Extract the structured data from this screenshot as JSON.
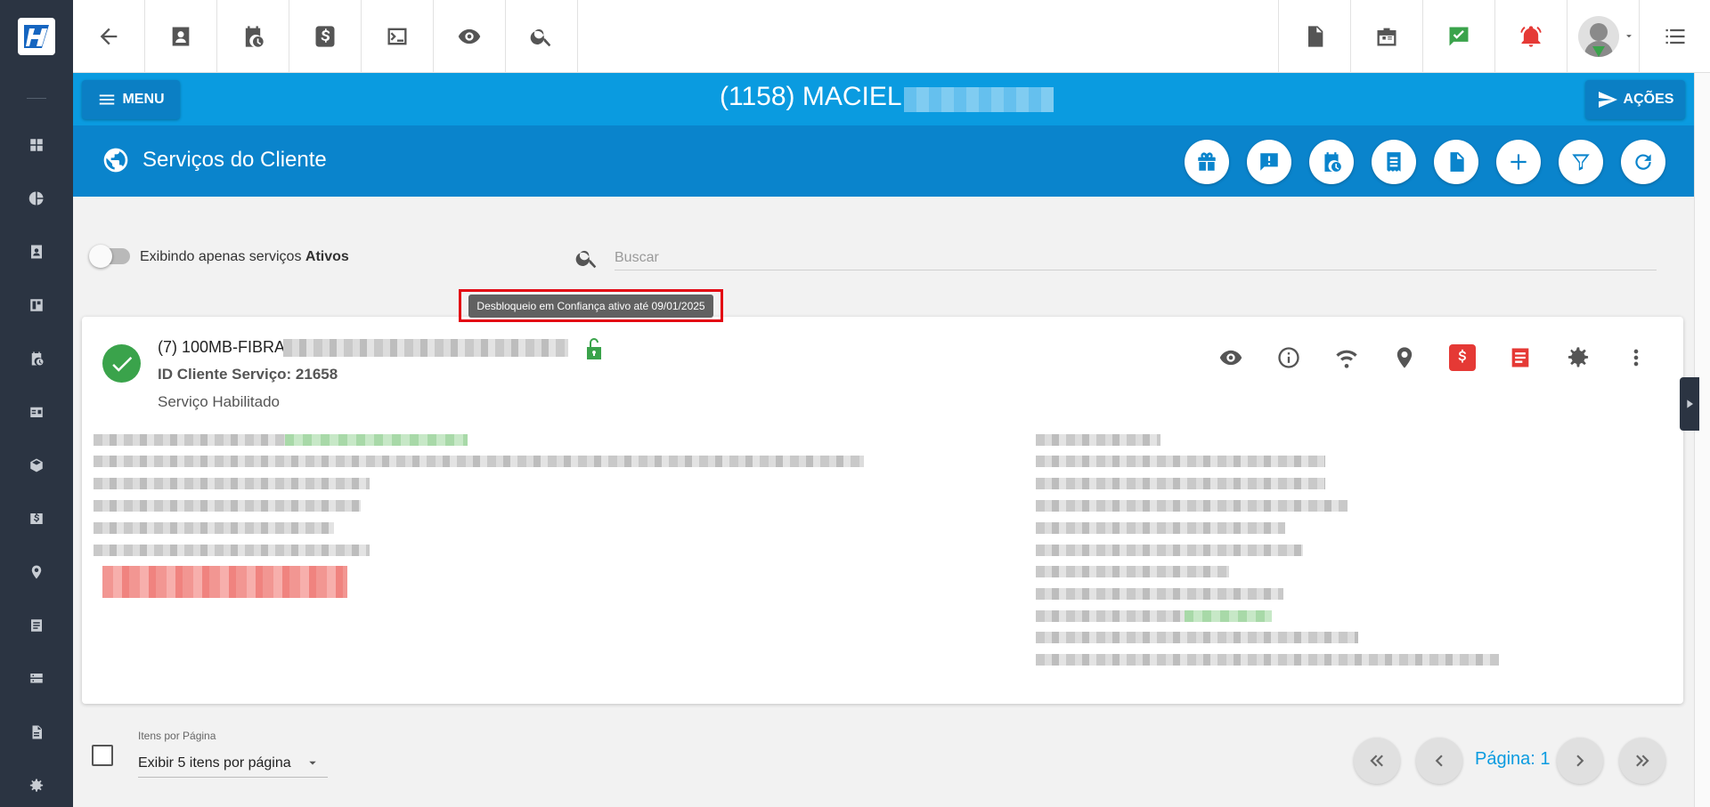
{
  "header": {
    "client_title": "(1158) MACIEL",
    "menu_label": "MENU",
    "acoes_label": "AÇÕES"
  },
  "page": {
    "title": "Serviços do Cliente"
  },
  "filter": {
    "toggle_label": "Exibindo apenas serviços ",
    "toggle_label_bold": "Ativos",
    "search_placeholder": "Buscar"
  },
  "tooltip": {
    "text": "Desbloqueio em Confiança ativo até 09/01/2025"
  },
  "service": {
    "name": "(7) 100MB-FIBRA",
    "id_line": "ID Cliente Serviço: 21658",
    "status": "Serviço Habilitado"
  },
  "footer": {
    "per_page_label": "Itens por Página",
    "per_page_value": "Exibir 5 itens por página",
    "page_label": "Página: 1"
  },
  "colors": {
    "sidebar": "#2b3442",
    "header_blue": "#0a9be0",
    "title_blue": "#0a84cc",
    "success_green": "#3aa34b",
    "alert_red": "#e53935",
    "highlight_red": "#e30613"
  }
}
